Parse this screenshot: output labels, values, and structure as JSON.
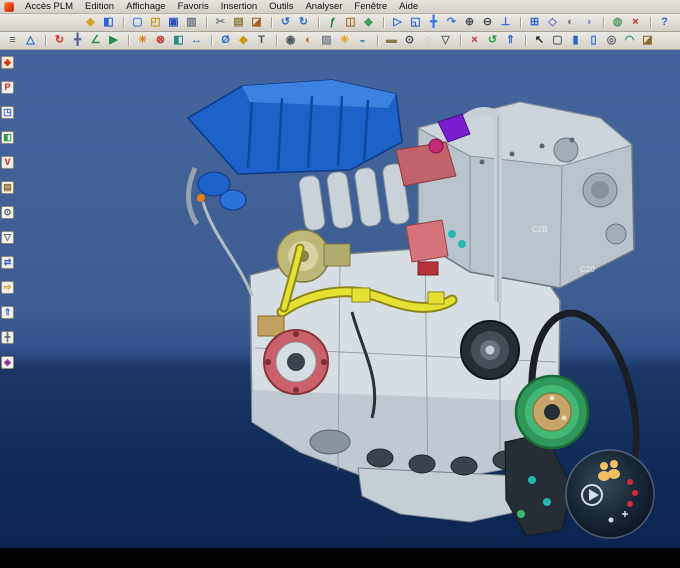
{
  "colors": {
    "chrome": "#d4d0c8",
    "viewport_top": "#44659b",
    "viewport_bottom": "#0c2550",
    "accent_blue": "#1d62c8",
    "alert_red": "#d42a2a"
  },
  "menubar": {
    "items": [
      {
        "name": "menu-acces-plm",
        "label": "Accès PLM"
      },
      {
        "name": "menu-edition",
        "label": "Edition"
      },
      {
        "name": "menu-affichage",
        "label": "Affichage"
      },
      {
        "name": "menu-favoris",
        "label": "Favoris"
      },
      {
        "name": "menu-insertion",
        "label": "Insertion"
      },
      {
        "name": "menu-outils",
        "label": "Outils"
      },
      {
        "name": "menu-analyser",
        "label": "Analyser"
      },
      {
        "name": "menu-fenetre",
        "label": "Fenêtre"
      },
      {
        "name": "menu-aide",
        "label": "Aide"
      }
    ]
  },
  "toolbar_top": {
    "items": [
      {
        "name": "plm-query-icon",
        "glyph": "◈",
        "color": "#d49a1a"
      },
      {
        "name": "plm-save-icon",
        "glyph": "◧",
        "color": "#2a5fd4"
      },
      {
        "name": "new-document-icon",
        "glyph": "▢",
        "color": "#4a7ae0",
        "gap": true
      },
      {
        "name": "open-icon",
        "glyph": "◰",
        "color": "#c89a10"
      },
      {
        "name": "save-icon",
        "glyph": "▣",
        "color": "#2a4fc0"
      },
      {
        "name": "print-icon",
        "glyph": "▥",
        "color": "#6a7480"
      },
      {
        "name": "cut-icon",
        "glyph": "✂",
        "color": "#7a828a",
        "gap": true
      },
      {
        "name": "copy-icon",
        "glyph": "▤",
        "color": "#8a7a3a"
      },
      {
        "name": "paste-icon",
        "glyph": "◪",
        "color": "#a0642a"
      },
      {
        "name": "undo-icon",
        "glyph": "↺",
        "color": "#2a6ad4",
        "gap": true
      },
      {
        "name": "redo-icon",
        "glyph": "↻",
        "color": "#2a6ad4"
      },
      {
        "name": "knowledge-icon",
        "glyph": "ƒ",
        "color": "#1a8a3a",
        "gap": true
      },
      {
        "name": "catalog-icon",
        "glyph": "◫",
        "color": "#b06a2a"
      },
      {
        "name": "material-icon",
        "glyph": "◆",
        "color": "#3aa05a"
      },
      {
        "name": "fly-mode-icon",
        "glyph": "▷",
        "color": "#2a6ad4",
        "gap": true
      },
      {
        "name": "fit-all-in-icon",
        "glyph": "◱",
        "color": "#2a6ad4"
      },
      {
        "name": "pan-icon",
        "glyph": "╋",
        "color": "#3a7ae0"
      },
      {
        "name": "rotate-icon",
        "glyph": "↷",
        "color": "#3a7ae0"
      },
      {
        "name": "zoom-in-icon",
        "glyph": "⊕",
        "color": "#4a545e"
      },
      {
        "name": "zoom-out-icon",
        "glyph": "⊖",
        "color": "#4a545e"
      },
      {
        "name": "normal-view-icon",
        "glyph": "⊥",
        "color": "#2a6ad4"
      },
      {
        "name": "multi-view-icon",
        "glyph": "⊞",
        "color": "#2a6ad4",
        "gap": true
      },
      {
        "name": "isometric-view-icon",
        "glyph": "◇",
        "color": "#6a74c0"
      },
      {
        "name": "shading-icon",
        "glyph": "◐",
        "color": "#6a7480"
      },
      {
        "name": "hide-show-icon",
        "glyph": "◑",
        "color": "#8a94d0"
      },
      {
        "name": "swap-visible-space-icon",
        "glyph": "◍",
        "color": "#5a9a6a",
        "gap": true
      },
      {
        "name": "delete-icon",
        "glyph": "×",
        "color": "#d42a2a"
      },
      {
        "name": "help-icon",
        "glyph": "?",
        "color": "#2a6ad4",
        "gap": true
      }
    ]
  },
  "toolbar_second": {
    "items": [
      {
        "name": "specification-tree-icon",
        "glyph": "≡",
        "color": "#4a545e"
      },
      {
        "name": "graph-view-icon",
        "glyph": "△",
        "color": "#2a6ad4"
      },
      {
        "name": "update-icon",
        "glyph": "↻",
        "color": "#d42a2a",
        "gap": true
      },
      {
        "name": "manipulation-icon",
        "glyph": "╋",
        "color": "#5a64a0"
      },
      {
        "name": "snap-icon",
        "glyph": "∠",
        "color": "#2a8a4a"
      },
      {
        "name": "smart-move-icon",
        "glyph": "▶",
        "color": "#2a8a4a"
      },
      {
        "name": "explode-icon",
        "glyph": "☀",
        "color": "#d4821a",
        "gap": true
      },
      {
        "name": "clash-analysis-icon",
        "glyph": "⊗",
        "color": "#d42a2a"
      },
      {
        "name": "section-icon",
        "glyph": "◧",
        "color": "#2a8a8a"
      },
      {
        "name": "distance-analysis-icon",
        "glyph": "↔",
        "color": "#2a6ad4"
      },
      {
        "name": "measure-icon",
        "glyph": "Ø",
        "color": "#2a6ad4",
        "gap": true
      },
      {
        "name": "mass-properties-icon",
        "glyph": "◆",
        "color": "#c89a10"
      },
      {
        "name": "annotation-icon",
        "glyph": "T",
        "color": "#4a545e"
      },
      {
        "name": "camera-icon",
        "glyph": "◉",
        "color": "#4a545e",
        "gap": true
      },
      {
        "name": "render-icon",
        "glyph": "◐",
        "color": "#c06a2a"
      },
      {
        "name": "texture-icon",
        "glyph": "▨",
        "color": "#7a848e"
      },
      {
        "name": "light-source-icon",
        "glyph": "☀",
        "color": "#e0a01a"
      },
      {
        "name": "depth-effect-icon",
        "glyph": "◒",
        "color": "#5a90c0"
      },
      {
        "name": "ground-icon",
        "glyph": "▬",
        "color": "#8a7a4a",
        "gap": true
      },
      {
        "name": "magnifier-icon",
        "glyph": "⊙",
        "color": "#3a444e"
      },
      {
        "name": "x-ray-icon",
        "glyph": "◌",
        "color": "#8a94d4"
      },
      {
        "name": "layer-filter-icon",
        "glyph": "▽",
        "color": "#5a646e"
      },
      {
        "name": "delete-element-icon",
        "glyph": "×",
        "color": "#d42a2a",
        "gap": true
      },
      {
        "name": "recycle-icon",
        "glyph": "↺",
        "color": "#2a9a4a"
      },
      {
        "name": "publish-icon",
        "glyph": "⇑",
        "color": "#2a6ad4"
      },
      {
        "name": "select-arrow-icon",
        "glyph": "↖",
        "color": "#20262c",
        "gap": true
      },
      {
        "name": "selection-box-icon",
        "glyph": "▢",
        "color": "#5a646e"
      },
      {
        "name": "pad-icon",
        "glyph": "▮",
        "color": "#2a6ad4"
      },
      {
        "name": "pocket-icon",
        "glyph": "▯",
        "color": "#2a6ad4"
      },
      {
        "name": "hole-icon",
        "glyph": "◎",
        "color": "#5a646e"
      },
      {
        "name": "fillet-icon",
        "glyph": "◠",
        "color": "#2a8a8a"
      },
      {
        "name": "apply-material-icon",
        "glyph": "◪",
        "color": "#8a6a2a"
      }
    ]
  },
  "left_toolbar": {
    "items": [
      {
        "name": "workbench-icon",
        "glyph": "◆",
        "color": "#d4341a",
        "bg": "#f4e8d0"
      },
      {
        "name": "plm-access-icon",
        "glyph": "P",
        "color": "#c81a2a",
        "bg": "#f0f0e8"
      },
      {
        "name": "product-structure-icon",
        "glyph": "◳",
        "color": "#2a5fd4",
        "bg": "#f0f0e8"
      },
      {
        "name": "part-design-icon",
        "glyph": "◧",
        "color": "#2a9a4a",
        "bg": "#f0f0e8"
      },
      {
        "name": "vpm-navigator-icon",
        "glyph": "V",
        "color": "#c81a2a",
        "bg": "#f0f0e8"
      },
      {
        "name": "cache-icon",
        "glyph": "▤",
        "color": "#8a6a2a",
        "bg": "#f0f0e8"
      },
      {
        "name": "search-icon",
        "glyph": "⊙",
        "color": "#3a444e",
        "bg": "#f0f0e8"
      },
      {
        "name": "filter-icon",
        "glyph": "▽",
        "color": "#5a646e",
        "bg": "#f0f0e8"
      },
      {
        "name": "link-manager-icon",
        "glyph": "⇄",
        "color": "#2a5fd4",
        "bg": "#f0f0e8"
      },
      {
        "name": "send-to-icon",
        "glyph": "⇨",
        "color": "#c89a10",
        "bg": "#f0f0e8"
      },
      {
        "name": "publish-left-icon",
        "glyph": "⇑",
        "color": "#2a5fd4",
        "bg": "#f0f0e8"
      },
      {
        "name": "options-icon",
        "glyph": "╋",
        "color": "#6a747e",
        "bg": "#f0f0e8"
      },
      {
        "name": "exit-workbench-icon",
        "glyph": "◈",
        "color": "#8a2a9a",
        "bg": "#f0f0e8"
      }
    ]
  },
  "viewport": {
    "part_labels": [
      "C2B",
      "C20"
    ]
  }
}
